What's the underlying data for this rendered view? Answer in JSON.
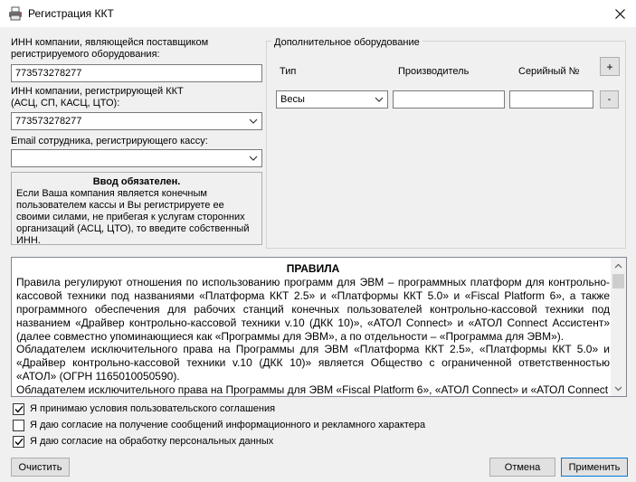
{
  "window": {
    "title": "Регистрация ККТ",
    "app_icon": "printer-icon",
    "close_icon": "close-icon"
  },
  "left": {
    "inn_supplier_label": "ИНН компании, являющейся поставщиком регистрируемого оборудования:",
    "inn_supplier_value": "773573278277",
    "inn_registrar_label_1": "ИНН компании, регистрирующей ККТ",
    "inn_registrar_label_2": "(АСЦ, СП, КАСЦ, ЦТО):",
    "inn_registrar_value": "773573278277",
    "email_label": "Email сотрудника, регистрирующего кассу:",
    "email_value": "",
    "notice_title": "Ввод обязателен.",
    "notice_text": "Если Ваша компания является конечным пользователем кассы и Вы регистрируете ее своими силами, не прибегая к услугам сторонних организаций (АСЦ, ЦТО), то введите собственный ИНН."
  },
  "equipment": {
    "group_title": "Дополнительное оборудование",
    "col_type": "Тип",
    "col_manufacturer": "Производитель",
    "col_serial": "Серийный №",
    "add_label": "+",
    "remove_label": "-",
    "rows": [
      {
        "type": "Весы",
        "manufacturer": "",
        "serial": ""
      }
    ]
  },
  "rules": {
    "title": "ПРАВИЛА",
    "paragraphs": [
      "Правила регулируют отношения по использованию программ для ЭВМ – программных платформ для контрольно-кассовой техники под названиями «Платформа ККТ 2.5» и «Платформы ККТ 5.0» и «Fiscal Platform 6», а также программного обеспечения для рабочих станций конечных пользователей контрольно-кассовой техники под названием «Драйвер контрольно-кассовой техники v.10 (ДКК 10)», «АТОЛ Connect» и «АТОЛ Connect Ассистент» (далее совместно упоминающиеся как «Программы для ЭВМ», а по отдельности – «Программа для ЭВМ»).",
      "Обладателем исключительного права на Программы для ЭВМ «Платформа ККТ 2.5», «Платформы ККТ 5.0» и «Драйвер контрольно-кассовой техники v.10 (ДКК 10)» является Общество с ограниченной ответственностью «АТОЛ» (ОГРН 1165010050590).",
      "Обладателем исключительного права на Программы для ЭВМ «Fiscal Platform 6», «АТОЛ Connect» и «АТОЛ Connect"
    ]
  },
  "consents": [
    {
      "label": "Я принимаю условия пользовательского соглашения",
      "checked": true
    },
    {
      "label": "Я даю согласие на получение сообщений информационного и рекламного характера",
      "checked": false
    },
    {
      "label": "Я даю согласие на обработку персональных данных",
      "checked": true
    }
  ],
  "buttons": {
    "clear": "Очистить",
    "cancel": "Отмена",
    "apply": "Применить"
  }
}
